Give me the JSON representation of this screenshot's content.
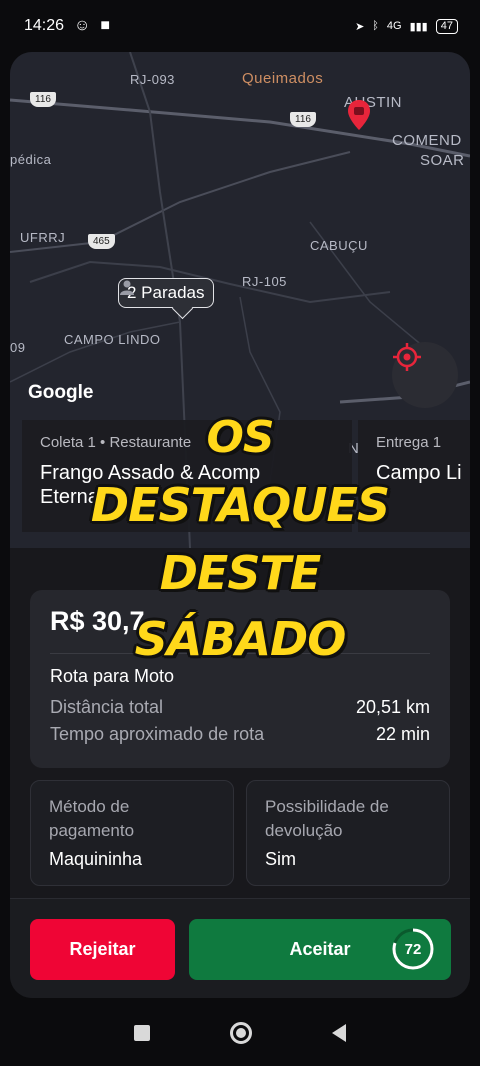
{
  "status_bar": {
    "time": "14:26",
    "network": "4G",
    "battery": "47"
  },
  "map": {
    "labels": {
      "rj093": "RJ-093",
      "queimados": "Queimados",
      "austin": "AUSTIN",
      "comend": "COMEND",
      "soar": "SOAR",
      "pedica": "pédica",
      "ufrrj": "UFRRJ",
      "cabucu": "CABUÇU",
      "rj105": "RJ-105",
      "campo_lindo": "CAMPO LINDO",
      "nine": "09",
      "n": "N"
    },
    "shields": {
      "s116a": "116",
      "s116b": "116",
      "s465": "465"
    },
    "stops_tag": "2 Paradas",
    "google": "Google"
  },
  "stops": [
    {
      "caption": "Coleta 1 • Restaurante",
      "name_line1": "Frango Assado & Acomp",
      "name_line2": "Eterna"
    },
    {
      "caption": "Entrega 1",
      "name_line1": "Campo Li"
    }
  ],
  "order": {
    "price": "R$ 30,7",
    "route_type": "Rota para Moto",
    "distance_label": "Distância total",
    "distance_value": "20,51 km",
    "time_label": "Tempo aproximado de rota",
    "time_value": "22 min"
  },
  "payment": {
    "label_line1": "Método de",
    "label_line2": "pagamento",
    "value": "Maquininha"
  },
  "return": {
    "label_line1": "Possibilidade de",
    "label_line2": "devolução",
    "value": "Sim"
  },
  "actions": {
    "reject": "Rejeitar",
    "accept": "Aceitar",
    "timer": "72",
    "timer_fraction": 0.8
  },
  "overlay_caption": {
    "line1": "OS",
    "line2": "DESTAQUES",
    "line3": "DESTE",
    "line4": "SÁBADO"
  },
  "colors": {
    "reject": "#ef0535",
    "accept": "#0f7a3f",
    "caption": "#ffd81a",
    "pin": "#e8253b"
  }
}
